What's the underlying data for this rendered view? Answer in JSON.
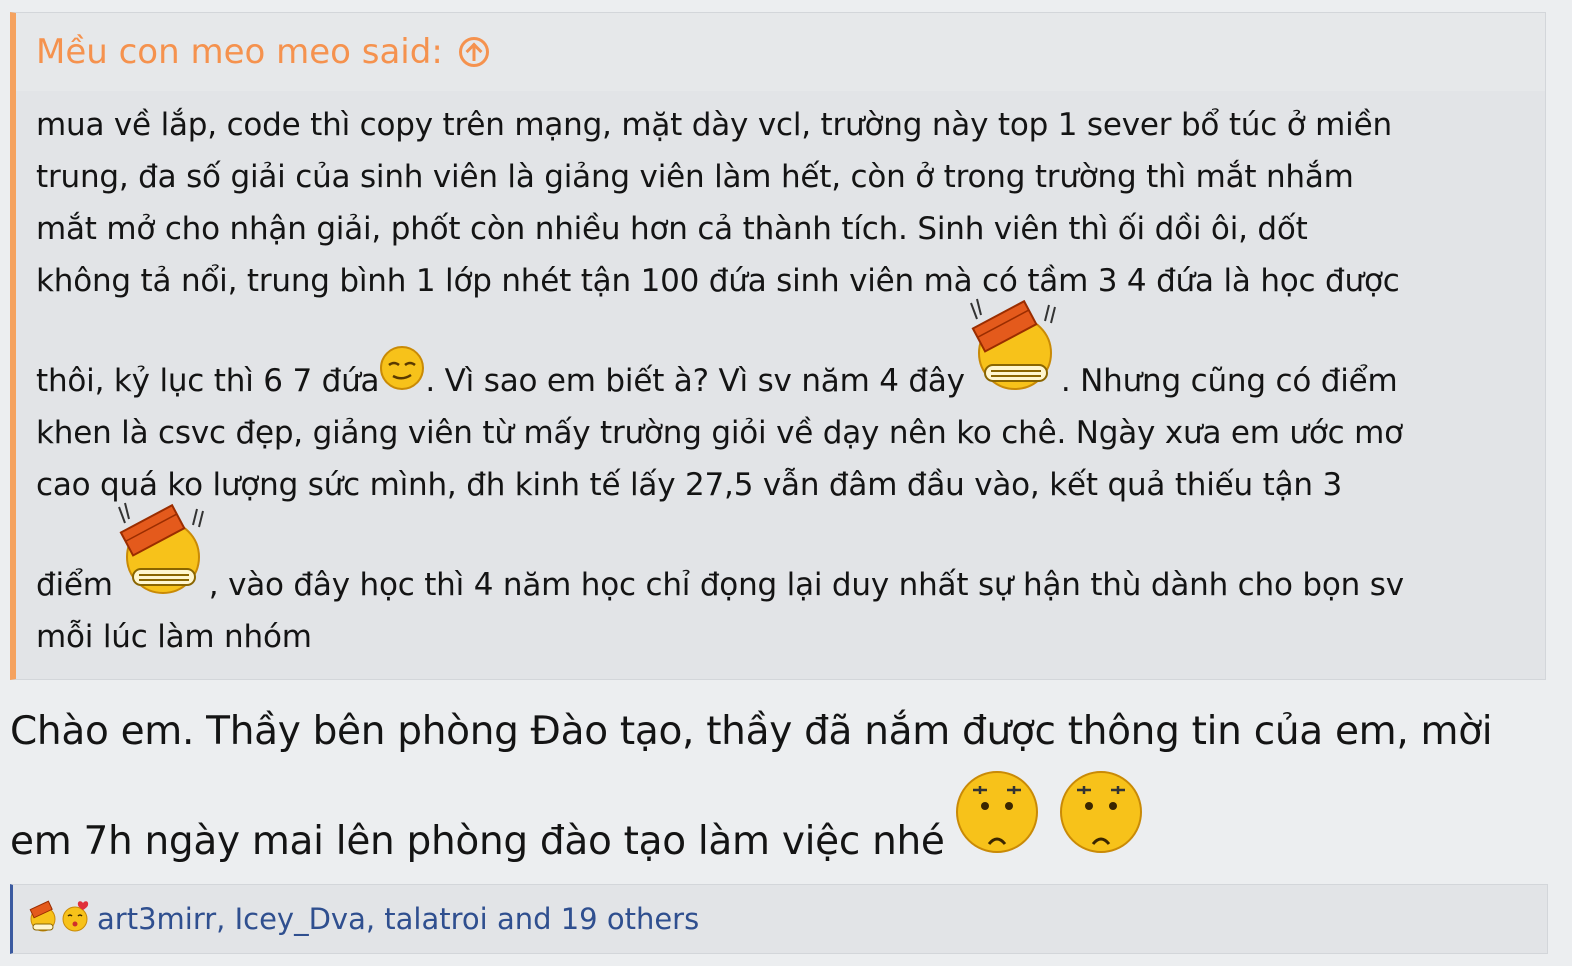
{
  "quote": {
    "author_said": "Mều con meo meo said:",
    "lines": [
      "mua về lắp, code thì copy trên mạng, mặt dày vcl, trường này top 1 sever bổ túc ở miền",
      "trung, đa số giải của sinh viên là giảng viên làm hết, còn ở trong trường thì mắt nhắm",
      "mắt mở cho nhận giải, phốt còn nhiều hơn cả thành tích. Sinh viên thì ối dồi ôi, dốt",
      "không tả nổi, trung bình 1 lớp nhét tận 100 đứa sinh viên mà có tầm 3 4 đứa là học được"
    ],
    "line5": {
      "a": "thôi, kỷ lục thì 6 7 đứa ",
      "b": ". Vì sao em biết à? Vì sv năm 4 đây ",
      "c": ". Nhưng cũng có điểm"
    },
    "lines_b": [
      "khen là csvc đẹp, giảng viên từ mấy trường giỏi về dạy nên ko chê. Ngày xưa em ước mơ",
      "cao quá ko lượng sức mình, đh kinh tế lấy 27,5 vẫn đâm đầu vào, kết quả thiếu tận 3"
    ],
    "line8": {
      "a": "điểm ",
      "b": ", vào đây học thì 4 năm học chỉ đọng lại duy nhất sự hận thù dành cho bọn sv"
    },
    "last_line": "mỗi lúc làm nhóm"
  },
  "reply": {
    "line1": "Chào em. Thầy bên phòng Đào tạo, thầy đã nắm được thông tin của em, mời",
    "line2": "em 7h ngày mai lên phòng đào tạo làm việc nhé "
  },
  "reactions": {
    "text": "art3mirr, Icey_Dva, talatroi and 19 others"
  },
  "colors": {
    "quote_accent": "#f5924e",
    "reaction_link": "#2f4f8f",
    "background": "#eceef0"
  },
  "icons": [
    "arrow-up-circle-icon",
    "smug-emoji-icon",
    "brick-head-emoji-icon",
    "frown-emoji-icon",
    "kiss-emoji-icon"
  ]
}
